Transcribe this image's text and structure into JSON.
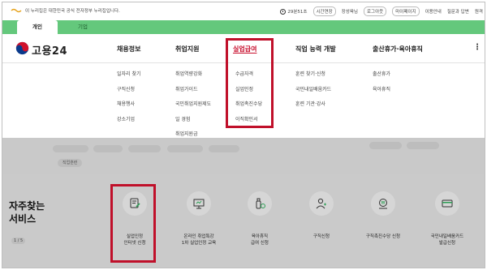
{
  "topbar": {
    "gov_notice": "이 누리집은 대한민국 공식 전자정부 누리집입니다.",
    "timer": "29분51초",
    "extend": "시간연장",
    "user": "장성육님",
    "logout": "로그아웃",
    "mypage": "마이페이지",
    "guide": "이용안내",
    "faq": "질문과 답변",
    "zoom": "원격"
  },
  "tabs": {
    "personal": "개인",
    "corporate": "기업"
  },
  "logo": "고용24",
  "nav": {
    "jobs": "채용정보",
    "employment_support": "취업지원",
    "unemployment": "실업급여",
    "skills": "직업 능력 개발",
    "leave": "출산휴가·육아휴직",
    "more": "⋮"
  },
  "menu": {
    "jobs": [
      "일자리 찾기",
      "구직신청",
      "채용행사",
      "강소기업"
    ],
    "employment_support": [
      "취업역량강화",
      "취업가이드",
      "국민취업지원제도",
      "일 경험",
      "취업지원금"
    ],
    "unemployment": [
      "수급자격",
      "실업인정",
      "취업촉진수당",
      "이직확인서"
    ],
    "skills": [
      "훈련 찾기·신청",
      "국민내일배움카드",
      "훈련 기관·강사"
    ],
    "leave": [
      "출산휴가",
      "육아휴직"
    ]
  },
  "dimmed_chip": "직업훈련",
  "services": {
    "title_line1": "자주찾는",
    "title_line2": "서비스",
    "page": "1 / 5",
    "items": [
      {
        "line1": "실업인정",
        "line2": "인터넷 신청"
      },
      {
        "line1": "온라인 취업특강",
        "line2": "1차 실업인정 교육"
      },
      {
        "line1": "육아휴직",
        "line2": "급여 신청"
      },
      {
        "line1": "구직신청",
        "line2": ""
      },
      {
        "line1": "구직촉진수당 신청",
        "line2": ""
      },
      {
        "line1": "국민내일배움카드",
        "line2": "발급신청"
      }
    ]
  },
  "colors": {
    "green": "#64c87c",
    "highlight": "#c0102a",
    "active_nav": "#c8102e"
  }
}
